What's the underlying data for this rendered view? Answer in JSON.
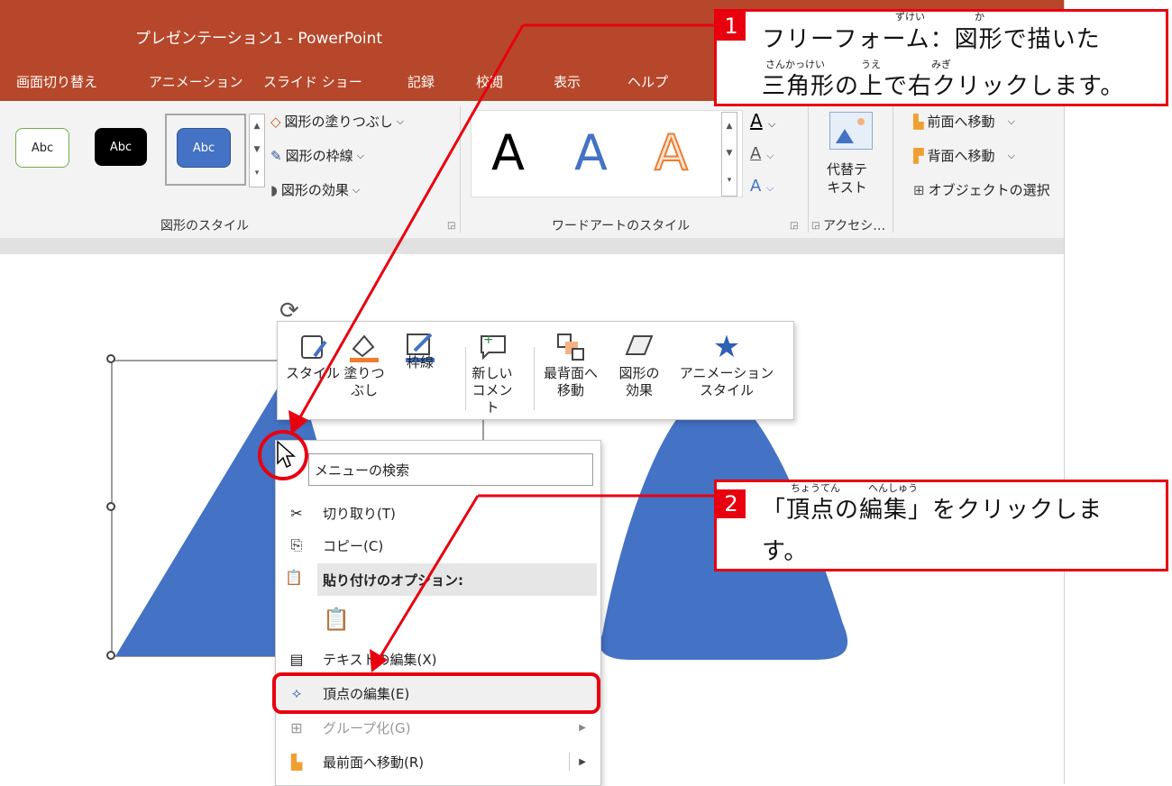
{
  "window": {
    "title": "プレゼンテーション1 - PowerPoint"
  },
  "tabs": [
    "画面切り替え",
    "アニメーション",
    "スライド ショー",
    "記録",
    "校閲",
    "表示",
    "ヘルプ"
  ],
  "ribbon": {
    "shape_styles": {
      "samples": [
        "Abc",
        "Abc",
        "Abc"
      ],
      "fill": "図形の塗りつぶし",
      "outline": "図形の枠線",
      "effects": "図形の効果",
      "label": "図形のスタイル"
    },
    "wordart": {
      "samples": [
        "A",
        "A",
        "A"
      ],
      "label": "ワードアートのスタイル"
    },
    "accessibility": {
      "alt_text_line1": "代替テ",
      "alt_text_line2": "キスト",
      "label": "アクセシ…"
    },
    "arrange": {
      "bring_forward": "前面へ移動",
      "send_backward": "背面へ移動",
      "selection_pane": "オブジェクトの選択"
    }
  },
  "mini_toolbar": [
    {
      "line1": "スタイル",
      "line2": ""
    },
    {
      "line1": "塗りつ",
      "line2": "ぶし"
    },
    {
      "line1": "枠線",
      "line2": ""
    },
    {
      "line1": "新しい",
      "line2": "コメント"
    },
    {
      "line1": "最背面へ",
      "line2": "移動"
    },
    {
      "line1": "図形の",
      "line2": "効果"
    },
    {
      "line1": "アニメーション",
      "line2": "スタイル"
    }
  ],
  "context_menu": {
    "search_placeholder": "メニューの検索",
    "items": {
      "cut": "切り取り(T)",
      "copy": "コピー(C)",
      "paste_options": "貼り付けのオプション:",
      "edit_text": "テキストの編集(X)",
      "edit_points": "頂点の編集(E)",
      "group": "グループ化(G)",
      "bring_to_front": "最前面へ移動(R)"
    }
  },
  "callouts": [
    {
      "number": "1",
      "line1": "フリーフォーム：図形で描いた",
      "line2": "三角形の上で右クリックします。",
      "ruby": [
        "ずけい",
        "か",
        "さんかっけい",
        "うえ",
        "みぎ"
      ]
    },
    {
      "number": "2",
      "line1": "「頂点の編集」をクリックしま",
      "line2": "す。",
      "ruby": [
        "ちょうてん",
        "へんしゅう"
      ]
    }
  ],
  "colors": {
    "title_bar": "#b7472a",
    "shape_fill": "#4472c4",
    "callout_red": "#e8000f"
  }
}
